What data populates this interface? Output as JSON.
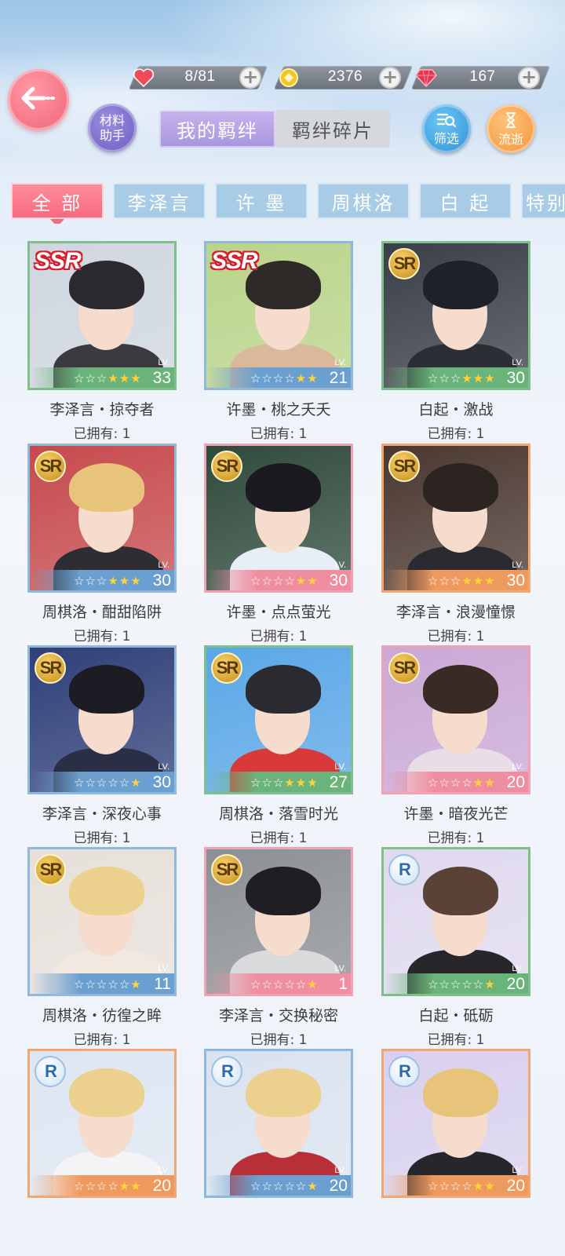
{
  "resources": {
    "stamina": {
      "icon": "heart-icon",
      "value": "8/81"
    },
    "coins": {
      "icon": "coin-icon",
      "value": "2376"
    },
    "diamonds": {
      "icon": "diamond-icon",
      "value": "167"
    }
  },
  "header": {
    "materials_label_1": "材料",
    "materials_label_2": "助手",
    "tab_bonds": "我的羁绊",
    "tab_fragments": "羁绊碎片",
    "filter_label": "筛选",
    "time_label": "流逝"
  },
  "categories": [
    "全 部",
    "李泽言",
    "许 墨",
    "周棋洛",
    "白 起",
    "特别"
  ],
  "active_category": "全 部",
  "cards": [
    {
      "rarity": "SSR",
      "stars": 3,
      "max_stars": 6,
      "lv": "33",
      "name": "李泽言・掠夺者",
      "owned": "已拥有: 1",
      "frame": "green",
      "bar": "#6ab37a",
      "bg": "#cfd6df",
      "hair": "#2a2a2e",
      "body": "#3a3a3f"
    },
    {
      "rarity": "SSR",
      "stars": 2,
      "max_stars": 6,
      "lv": "21",
      "name": "许墨・桃之夭夭",
      "owned": "已拥有: 1",
      "frame": "blue",
      "bar": "#6b9fcf",
      "bg": "#b9d48a",
      "hair": "#2e2a28",
      "body": "#d9b89c"
    },
    {
      "rarity": "SR",
      "stars": 3,
      "max_stars": 6,
      "lv": "30",
      "name": "白起・激战",
      "owned": "已拥有: 1",
      "frame": "green",
      "bar": "#6ab37a",
      "bg": "#3a3e47",
      "hair": "#1f2128",
      "body": "#2b2e35"
    },
    {
      "rarity": "SR",
      "stars": 3,
      "max_stars": 6,
      "lv": "30",
      "name": "周棋洛・酣甜陷阱",
      "owned": "已拥有: 1",
      "frame": "blue",
      "bar": "#6b9fcf",
      "bg": "#c64a4d",
      "hair": "#e8c47a",
      "body": "#2d2d33"
    },
    {
      "rarity": "SR",
      "stars": 2,
      "max_stars": 6,
      "lv": "30",
      "name": "许墨・点点萤光",
      "owned": "已拥有: 1",
      "frame": "pink",
      "bar": "#ee8ea0",
      "bg": "#2f4a3c",
      "hair": "#1b1b1f",
      "body": "#e8eef5"
    },
    {
      "rarity": "SR",
      "stars": 3,
      "max_stars": 6,
      "lv": "30",
      "name": "李泽言・浪漫憧憬",
      "owned": "已拥有: 1",
      "frame": "orange",
      "bar": "#ee9a5f",
      "bg": "#4a3830",
      "hair": "#2c2420",
      "body": "#2a2a30"
    },
    {
      "rarity": "SR",
      "stars": 1,
      "max_stars": 6,
      "lv": "30",
      "name": "李泽言・深夜心事",
      "owned": "已拥有: 1",
      "frame": "blue",
      "bar": "#6b9fcf",
      "bg": "#2f3f78",
      "hair": "#1c1c24",
      "body": "#2a2f45"
    },
    {
      "rarity": "SR",
      "stars": 3,
      "max_stars": 6,
      "lv": "27",
      "name": "周棋洛・落雪时光",
      "owned": "已拥有: 1",
      "frame": "green",
      "bar": "#6ab37a",
      "bg": "#5aa7e6",
      "hair": "#2a2a30",
      "body": "#d83a3a"
    },
    {
      "rarity": "SR",
      "stars": 2,
      "max_stars": 6,
      "lv": "20",
      "name": "许墨・暗夜光芒",
      "owned": "已拥有: 1",
      "frame": "pink",
      "bar": "#ee8ea0",
      "bg": "#c9a8d6",
      "hair": "#3a2a26",
      "body": "#e9dde6"
    },
    {
      "rarity": "SR",
      "stars": 1,
      "max_stars": 6,
      "lv": "11",
      "name": "周棋洛・彷徨之眸",
      "owned": "已拥有: 1",
      "frame": "blue",
      "bar": "#6b9fcf",
      "bg": "#e6e0da",
      "hair": "#ecd08e",
      "body": "#f2e8e0"
    },
    {
      "rarity": "SR",
      "stars": 1,
      "max_stars": 6,
      "lv": "1",
      "name": "李泽言・交换秘密",
      "owned": "已拥有: 1",
      "frame": "pink",
      "bar": "#ee8ea0",
      "bg": "#8c8f94",
      "hair": "#1e1e24",
      "body": "#d9dadc"
    },
    {
      "rarity": "R",
      "stars": 1,
      "max_stars": 6,
      "lv": "20",
      "name": "白起・砥砺",
      "owned": "已拥有: 1",
      "frame": "green",
      "bar": "#6ab37a",
      "bg": "#e0d9ef",
      "hair": "#5a4236",
      "body": "#26262b"
    },
    {
      "rarity": "R",
      "stars": 2,
      "max_stars": 6,
      "lv": "20",
      "name": "",
      "owned": "",
      "frame": "orange",
      "bar": "#ee9a5f",
      "bg": "#dde6f2",
      "hair": "#ecd08e",
      "body": "#f4f4f6"
    },
    {
      "rarity": "R",
      "stars": 1,
      "max_stars": 6,
      "lv": "20",
      "name": "",
      "owned": "",
      "frame": "blue",
      "bar": "#6b9fcf",
      "bg": "#d9e3ef",
      "hair": "#ecd08e",
      "body": "#b92f38"
    },
    {
      "rarity": "R",
      "stars": 2,
      "max_stars": 6,
      "lv": "20",
      "name": "",
      "owned": "",
      "frame": "orange",
      "bar": "#ee9a5f",
      "bg": "#d8d0ee",
      "hair": "#e8c47a",
      "body": "#26262b"
    }
  ]
}
